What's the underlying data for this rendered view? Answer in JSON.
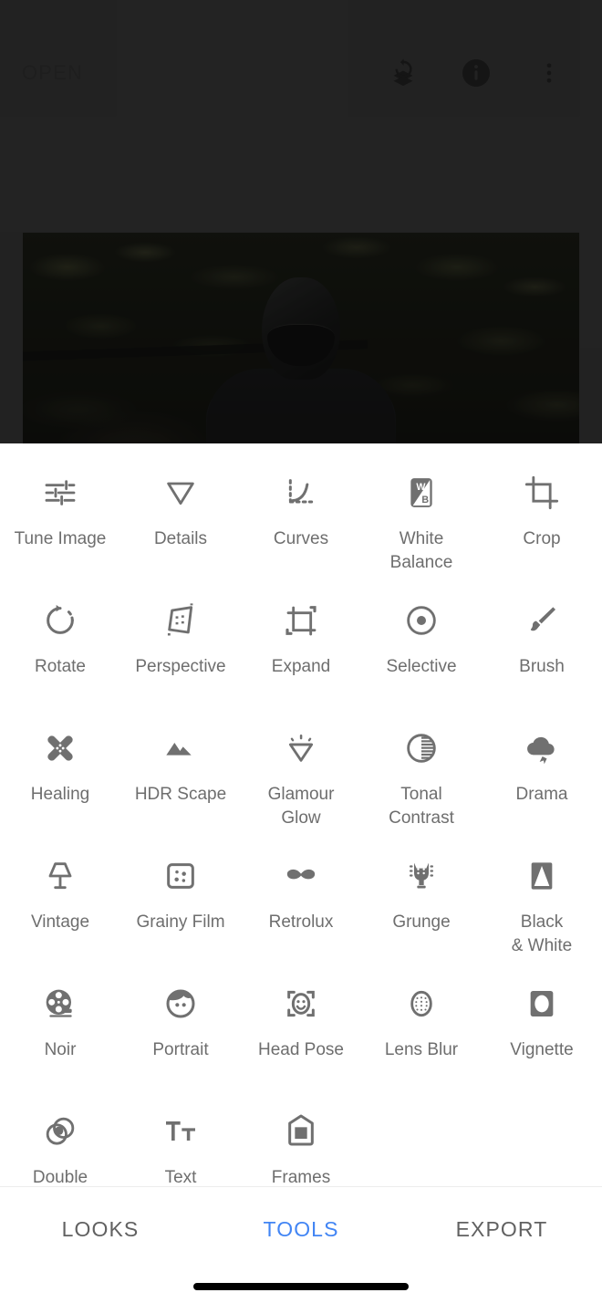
{
  "topbar": {
    "open_label": "OPEN",
    "actions": [
      {
        "name": "revert-stack-icon",
        "label": "Revert / Stacks"
      },
      {
        "name": "info-icon",
        "label": "Info"
      },
      {
        "name": "overflow-menu-icon",
        "label": "More options"
      }
    ]
  },
  "photo": {
    "alt": "Dark photo of a person wearing a black motorcycle helmet and jacket in front of dense foliage"
  },
  "tools": {
    "items": [
      {
        "label": "Tune Image",
        "icon": "tune-icon"
      },
      {
        "label": "Details",
        "icon": "details-icon"
      },
      {
        "label": "Curves",
        "icon": "curves-icon"
      },
      {
        "label": "White\nBalance",
        "icon": "white-balance-icon"
      },
      {
        "label": "Crop",
        "icon": "crop-icon"
      },
      {
        "label": "Rotate",
        "icon": "rotate-icon"
      },
      {
        "label": "Perspective",
        "icon": "perspective-icon"
      },
      {
        "label": "Expand",
        "icon": "expand-icon"
      },
      {
        "label": "Selective",
        "icon": "selective-icon"
      },
      {
        "label": "Brush",
        "icon": "brush-icon"
      },
      {
        "label": "Healing",
        "icon": "healing-icon"
      },
      {
        "label": "HDR Scape",
        "icon": "hdr-scape-icon"
      },
      {
        "label": "Glamour\nGlow",
        "icon": "glamour-glow-icon"
      },
      {
        "label": "Tonal\nContrast",
        "icon": "tonal-contrast-icon"
      },
      {
        "label": "Drama",
        "icon": "drama-icon"
      },
      {
        "label": "Vintage",
        "icon": "vintage-icon"
      },
      {
        "label": "Grainy Film",
        "icon": "grainy-film-icon"
      },
      {
        "label": "Retrolux",
        "icon": "retrolux-icon"
      },
      {
        "label": "Grunge",
        "icon": "grunge-icon"
      },
      {
        "label": "Black\n& White",
        "icon": "black-and-white-icon"
      },
      {
        "label": "Noir",
        "icon": "noir-icon"
      },
      {
        "label": "Portrait",
        "icon": "portrait-icon"
      },
      {
        "label": "Head Pose",
        "icon": "head-pose-icon"
      },
      {
        "label": "Lens Blur",
        "icon": "lens-blur-icon"
      },
      {
        "label": "Vignette",
        "icon": "vignette-icon"
      },
      {
        "label": "Double\nExposure",
        "icon": "double-exposure-icon"
      },
      {
        "label": "Text",
        "icon": "text-icon"
      },
      {
        "label": "Frames",
        "icon": "frames-icon"
      }
    ]
  },
  "bottom_nav": {
    "items": [
      {
        "label": "LOOKS",
        "active": false
      },
      {
        "label": "TOOLS",
        "active": true
      },
      {
        "label": "EXPORT",
        "active": false
      }
    ],
    "active_color": "#4285F4",
    "inactive_color": "#616161"
  }
}
